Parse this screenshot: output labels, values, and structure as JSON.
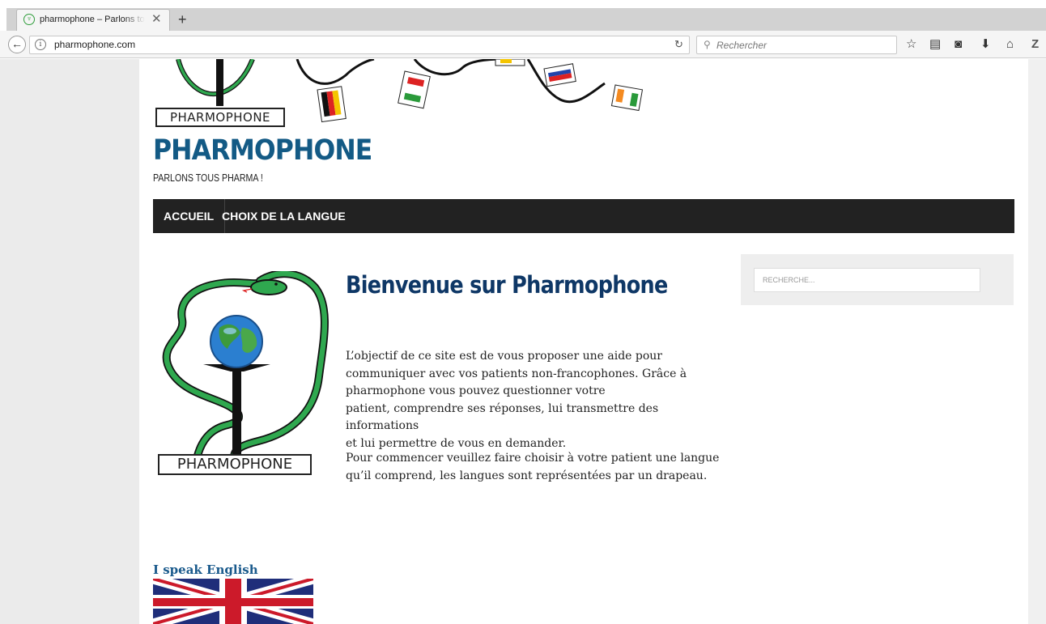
{
  "browser": {
    "tab_title": "pharmophone – Parlons tous pharma !",
    "tab_close": "✕",
    "new_tab": "+",
    "url": "pharmophone.com",
    "search_placeholder": "Rechercher"
  },
  "site": {
    "header_logo_text": "PHARMOPHONE",
    "title": "PHARMOPHONE",
    "tagline": "PARLONS TOUS PHARMA !"
  },
  "menu": {
    "items": [
      {
        "label": "ACCUEIL"
      },
      {
        "label": "CHOIX DE LA LANGUE"
      }
    ]
  },
  "main": {
    "logo_caption": "PHARMOPHONE",
    "title": "Bienvenue sur Pharmophone",
    "paragraph1_lines": [
      "L’objectif de ce site est de vous proposer une aide pour",
      "communiquer avec vos patients non-francophones. Grâce à",
      "pharmophone vous pouvez questionner votre",
      "patient, comprendre ses réponses, lui transmettre des informations",
      "et lui permettre de vous en demander."
    ],
    "paragraph2_lines": [
      "Pour commencer veuillez faire choisir à votre patient une langue",
      "qu’il comprend, les langues sont représentées par un drapeau."
    ],
    "language_english_label": "I speak English"
  },
  "sidebar": {
    "search_placeholder": "RECHERCHE..."
  },
  "colors": {
    "title_blue": "#135a85",
    "heading_navy": "#0e3766",
    "menu_bg": "#222222",
    "snake_green": "#2fa84f"
  }
}
